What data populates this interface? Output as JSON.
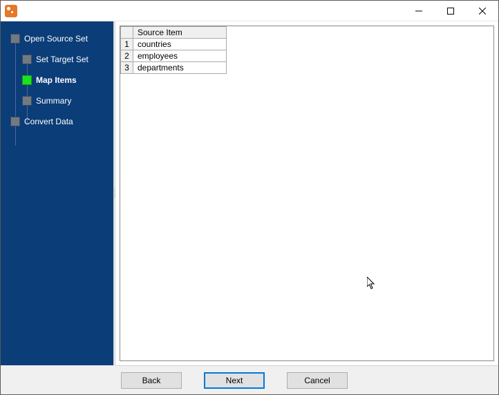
{
  "sidebar": {
    "steps": [
      {
        "label": "Open Source Set",
        "level": "top",
        "active": false
      },
      {
        "label": "Set Target Set",
        "level": "child",
        "active": false
      },
      {
        "label": "Map Items",
        "level": "child",
        "active": true
      },
      {
        "label": "Summary",
        "level": "child",
        "active": false
      },
      {
        "label": "Convert Data",
        "level": "top",
        "active": false
      }
    ]
  },
  "table": {
    "header": "Source Item",
    "rows": [
      {
        "n": "1",
        "item": "countries"
      },
      {
        "n": "2",
        "item": "employees"
      },
      {
        "n": "3",
        "item": "departments"
      }
    ]
  },
  "buttons": {
    "back": "Back",
    "next": "Next",
    "cancel": "Cancel"
  }
}
